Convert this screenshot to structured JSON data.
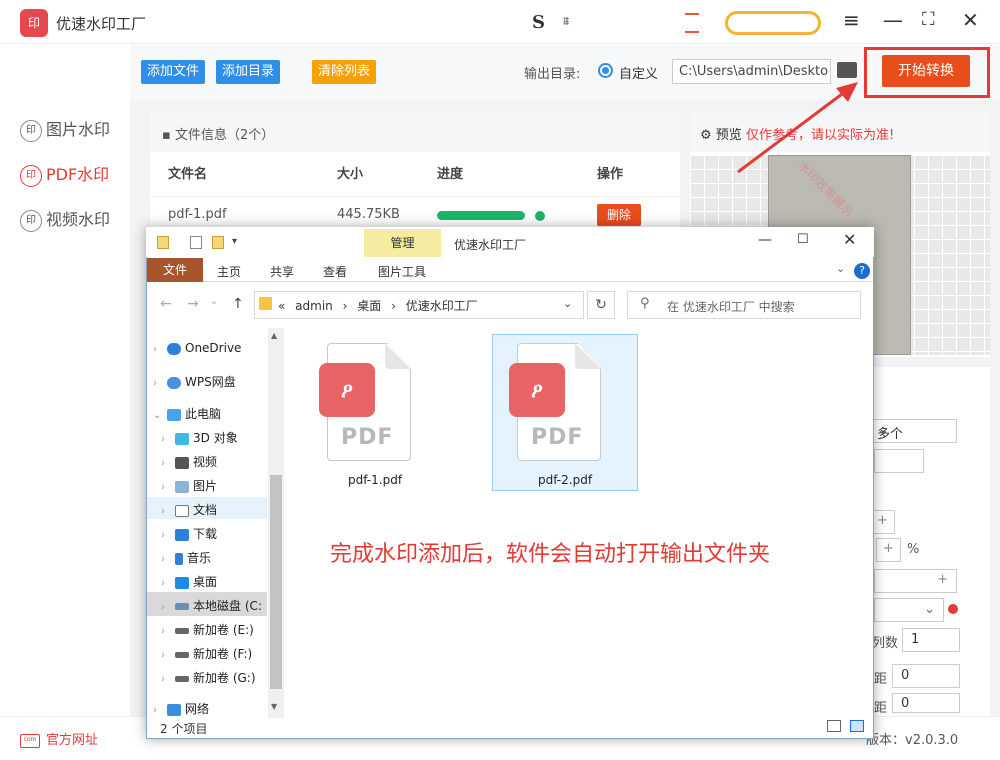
{
  "app": {
    "logo": "印",
    "title": "优速水印工厂"
  },
  "titlebar": {
    "menu_icon": "hamburger-icon",
    "min": "—",
    "max": "⛶",
    "close": "✕"
  },
  "sidebar": {
    "items": [
      {
        "label": "图片水印",
        "active": false
      },
      {
        "label": "PDF水印",
        "active": true
      },
      {
        "label": "视频水印",
        "active": false
      }
    ],
    "icon_glyph": "印"
  },
  "toolbar": {
    "add_file": "添加文件",
    "add_dir": "添加目录",
    "clear_list": "清除列表",
    "output_label": "输出目录:",
    "radio_label": "自定义",
    "output_path": "C:\\Users\\admin\\Deskto",
    "start": "开始转换"
  },
  "file_panel": {
    "header": "文件信息（2个）",
    "columns": [
      "文件名",
      "大小",
      "进度",
      "操作"
    ],
    "rows": [
      {
        "name": "pdf-1.pdf",
        "size": "445.75KB",
        "progress": 1.0,
        "action": "删除"
      }
    ]
  },
  "preview": {
    "label": "预览",
    "warning": "仅作参考，请以实际为准!",
    "watermark": "水印效果展示"
  },
  "settings": {
    "mode": "多个",
    "percent": "%",
    "cols_label": "列数",
    "cols_value": "1",
    "gap_label1": "距",
    "gap_value1": "0",
    "gap_label2": "距",
    "gap_value2": "0",
    "plus": "+"
  },
  "bottom": {
    "site": "官方网址",
    "version": "版本：v2.0.3.0"
  },
  "explorer": {
    "manage_tab": "管理",
    "caption": "优速水印工厂",
    "ribbon_tabs": [
      "文件",
      "主页",
      "共享",
      "查看",
      "图片工具"
    ],
    "address": [
      "«",
      "admin",
      "›",
      "桌面",
      "›",
      "优速水印工厂"
    ],
    "search_placeholder": "在 优速水印工厂 中搜索",
    "tree": [
      {
        "label": "OneDrive",
        "icon": "onedrive-icon"
      },
      {
        "label": "WPS网盘",
        "icon": "wps-cloud-icon"
      },
      {
        "label": "此电脑",
        "icon": "computer-icon"
      },
      {
        "label": "3D 对象",
        "icon": "3d-objects-icon"
      },
      {
        "label": "视频",
        "icon": "video-icon"
      },
      {
        "label": "图片",
        "icon": "pictures-icon"
      },
      {
        "label": "文档",
        "icon": "documents-icon"
      },
      {
        "label": "下载",
        "icon": "download-icon"
      },
      {
        "label": "音乐",
        "icon": "music-icon"
      },
      {
        "label": "桌面",
        "icon": "desktop-icon"
      },
      {
        "label": "本地磁盘 (C:",
        "icon": "drive-icon"
      },
      {
        "label": "新加卷 (E:)",
        "icon": "drive-icon"
      },
      {
        "label": "新加卷 (F:)",
        "icon": "drive-icon"
      },
      {
        "label": "新加卷 (G:)",
        "icon": "drive-icon"
      },
      {
        "label": "网络",
        "icon": "network-icon"
      }
    ],
    "files": [
      {
        "name": "pdf-1.pdf"
      },
      {
        "name": "pdf-2.pdf"
      }
    ],
    "pdf_badge": "PDF",
    "note": "完成水印添加后，软件会自动打开输出文件夹",
    "status": "2 个项目"
  },
  "colors": {
    "accent_red": "#e53935",
    "blue": "#2f8fe8",
    "orange": "#f7a10a",
    "start": "#e84d1c",
    "progress": "#1db469"
  }
}
